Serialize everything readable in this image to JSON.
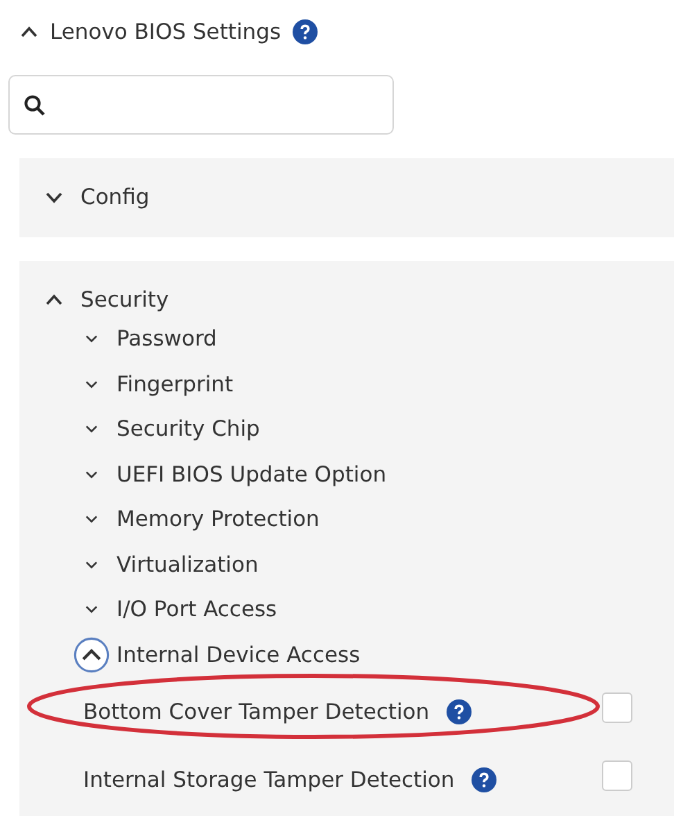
{
  "header": {
    "title": "Lenovo BIOS Settings",
    "expanded": true
  },
  "sections": [
    {
      "label": "Config",
      "expanded": false
    },
    {
      "label": "Security",
      "expanded": true,
      "children": [
        {
          "label": "Password",
          "expanded": false,
          "focused": false
        },
        {
          "label": "Fingerprint",
          "expanded": false,
          "focused": false
        },
        {
          "label": "Security Chip",
          "expanded": false,
          "focused": false
        },
        {
          "label": "UEFI BIOS Update Option",
          "expanded": false,
          "focused": false
        },
        {
          "label": "Memory Protection",
          "expanded": false,
          "focused": false
        },
        {
          "label": "Virtualization",
          "expanded": false,
          "focused": false
        },
        {
          "label": "I/O Port Access",
          "expanded": false,
          "focused": false
        },
        {
          "label": "Internal Device Access",
          "expanded": true,
          "focused": true
        }
      ],
      "settings": [
        {
          "label": "Bottom Cover Tamper Detection",
          "checked": false,
          "highlighted": true
        },
        {
          "label": "Internal Storage Tamper Detection",
          "checked": false,
          "highlighted": false
        }
      ]
    }
  ]
}
